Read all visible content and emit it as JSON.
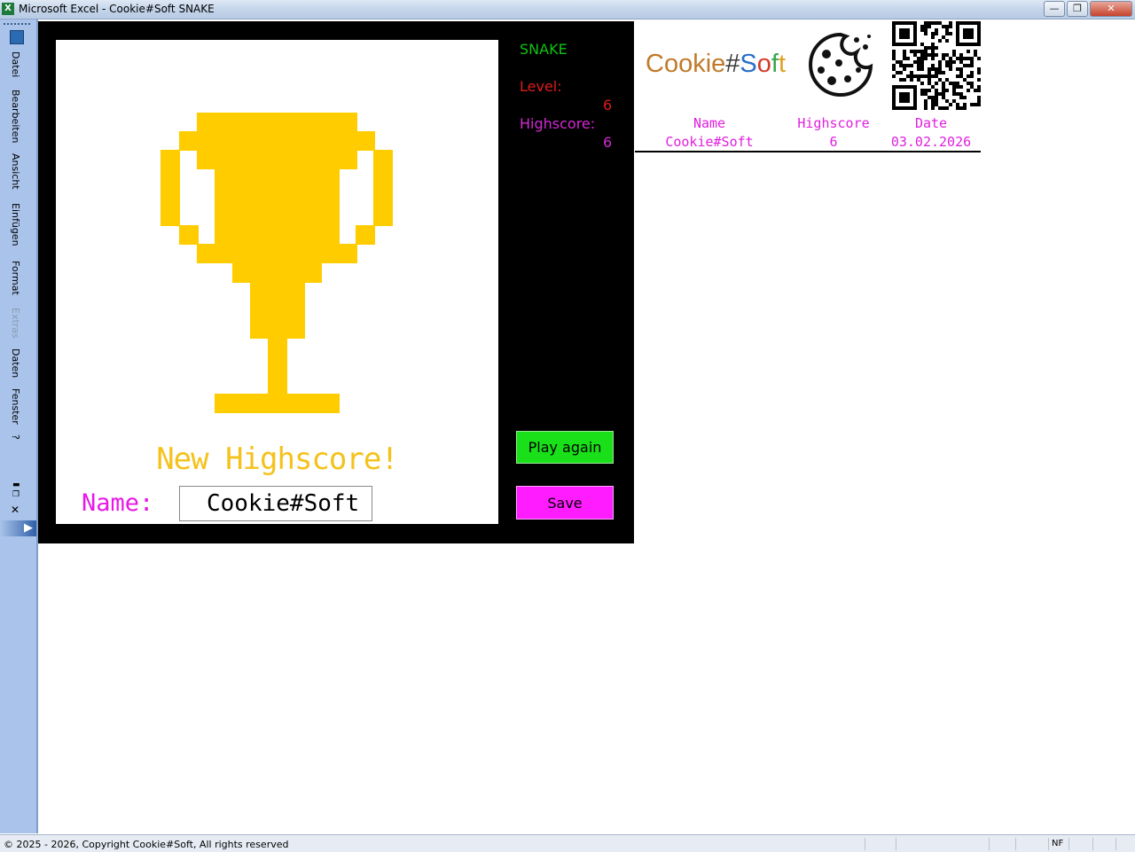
{
  "window": {
    "title": "Microsoft Excel - Cookie#Soft SNAKE",
    "app_icon": "X",
    "minimize": "—",
    "restore": "❐",
    "close": "✕"
  },
  "menubar": {
    "items": [
      {
        "label": "Datei",
        "enabled": true
      },
      {
        "label": "Bearbeiten",
        "enabled": true
      },
      {
        "label": "Ansicht",
        "enabled": true
      },
      {
        "label": "Einfügen",
        "enabled": true
      },
      {
        "label": "Format",
        "enabled": true
      },
      {
        "label": "Extras",
        "enabled": false
      },
      {
        "label": "Daten",
        "enabled": true
      },
      {
        "label": "Fenster",
        "enabled": true
      },
      {
        "label": "?",
        "enabled": true
      }
    ],
    "close_glyph": "✕",
    "arrow_glyph": "▶"
  },
  "game": {
    "title": "SNAKE",
    "level_label": "Level:",
    "level_value": "6",
    "highscore_label": "Highscore:",
    "highscore_value": "6",
    "new_highscore_text": "New Highscore!",
    "name_label": "Name:",
    "name_value": "Cookie#Soft",
    "play_again_label": "Play again",
    "save_label": "Save",
    "trophy_icon": "trophy-icon"
  },
  "brand": {
    "logo_text_parts": [
      {
        "text": "Cookie",
        "color": "#c07a2a"
      },
      {
        "text": "#",
        "color": "#3a3a3a"
      },
      {
        "text": "S",
        "color": "#2a6fc9"
      },
      {
        "text": "o",
        "color": "#d43a2a"
      },
      {
        "text": "f",
        "color": "#39a64a"
      },
      {
        "text": "t",
        "color": "#e0a020"
      }
    ]
  },
  "highscore_table": {
    "headers": [
      "Name",
      "Highscore",
      "Date"
    ],
    "rows": [
      [
        "Cookie#Soft",
        "6",
        "03.02.2026"
      ]
    ]
  },
  "status": {
    "text": "© 2025 - 2026, Copyright Cookie#Soft, All rights reserved",
    "indicator": "NF"
  },
  "colors": {
    "trophy": "#ffcc00",
    "game_bg": "#000000",
    "play_again": "#19e019",
    "save": "#ff1cff",
    "name_magenta": "#e817e8"
  }
}
